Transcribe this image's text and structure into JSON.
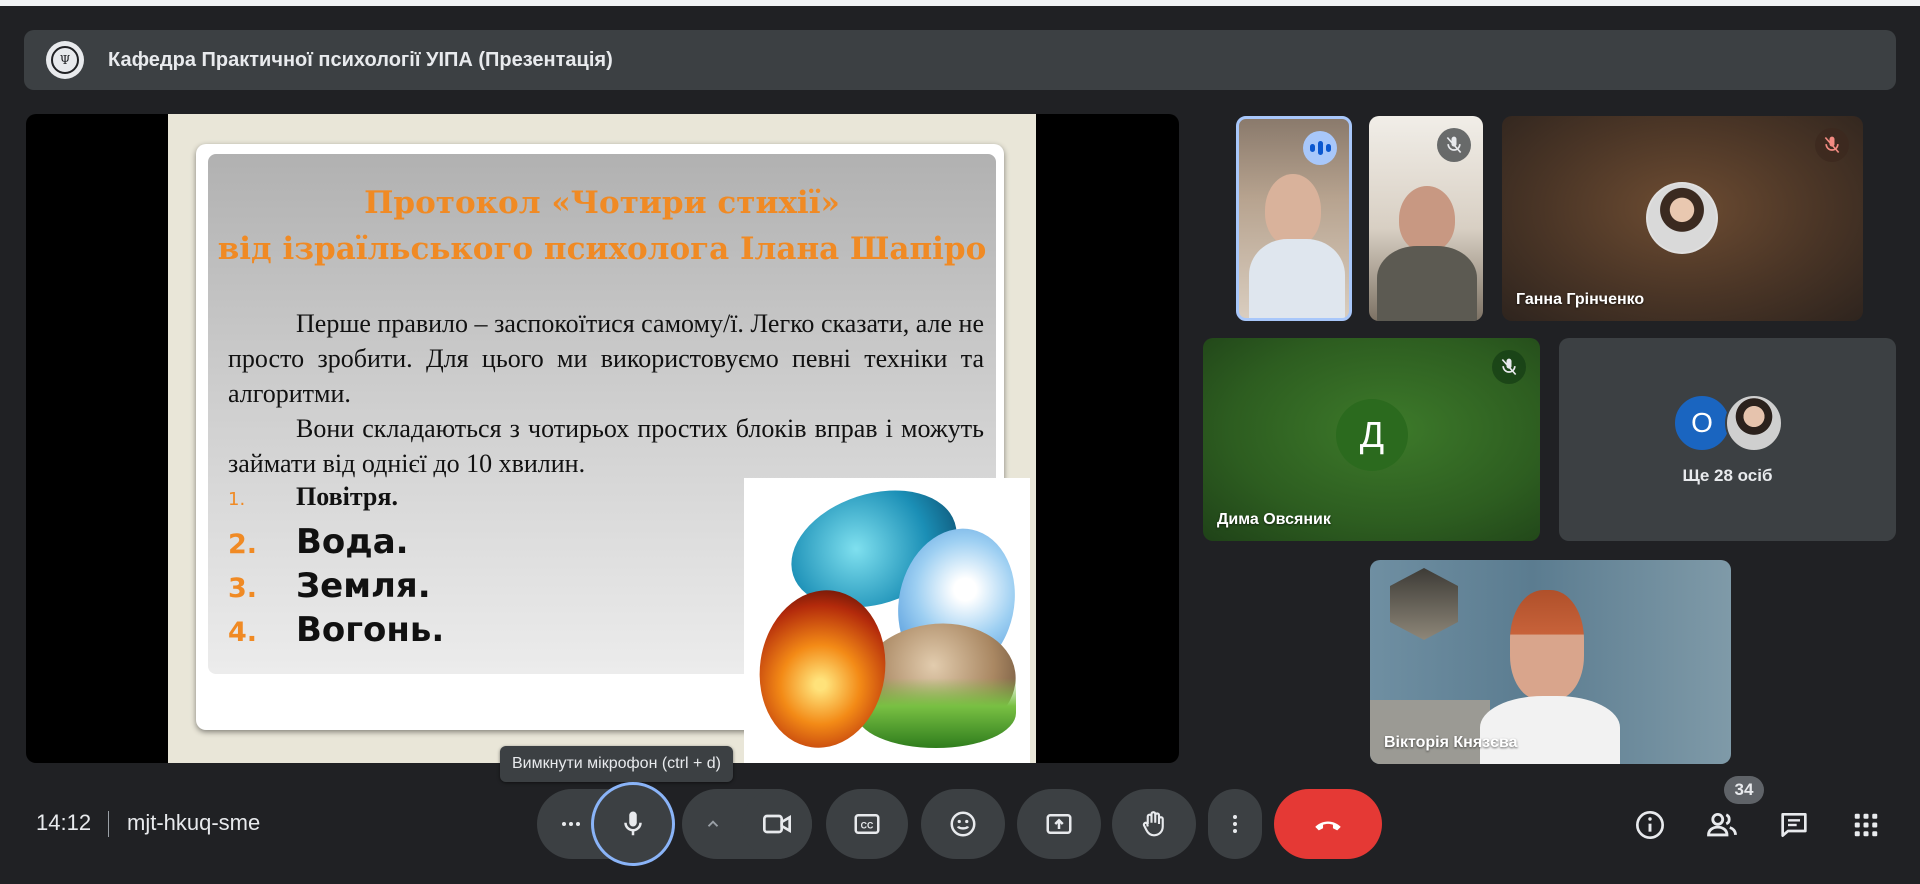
{
  "meeting": {
    "presentation_title": "Кафедра Практичної психології УІПА (Презентація)",
    "time": "14:12",
    "code": "mjt-hkuq-sme",
    "participant_count": "34"
  },
  "slide": {
    "title_line1": "Протокол «Чотири стихії»",
    "title_line2": "від ізраїльського психолога Ілана Шапіро",
    "paragraph1": "Перше правило – заспокоїтися самому/ї. Легко сказати, але не просто зробити. Для цього ми використовуємо певні техніки та алгоритми.",
    "paragraph2": "Вони складаються з чотирьох простих блоків вправ і можуть займати від однієї до 10 хвилин.",
    "list": [
      {
        "num": "1.",
        "text": "Повітря."
      },
      {
        "num": "2.",
        "text": "Вода."
      },
      {
        "num": "3.",
        "text": "Земля."
      },
      {
        "num": "4.",
        "text": "Вогонь."
      }
    ]
  },
  "participants": {
    "ganna": "Ганна Грінченко",
    "dima": "Дима Овсяник",
    "dima_initial": "Д",
    "more_initial": "О",
    "more_label": "Ще 28 осіб",
    "viktoriia": "Вікторія Князєва"
  },
  "tooltip": "Вимкнути мікрофон (ctrl + d)",
  "colors": {
    "accent": "#8ab4f8",
    "end_call": "#e53935",
    "slide_title": "#f08a24"
  },
  "icons": {
    "more_options": "more-horiz-icon",
    "mic": "mic-icon",
    "caret": "chevron-up-icon",
    "camera": "videocam-icon",
    "captions": "closed-caption-icon",
    "emoji": "emoji-icon",
    "present": "present-screen-icon",
    "hand": "raise-hand-icon",
    "more_vert": "more-vert-icon",
    "end": "call-end-icon",
    "info": "info-icon",
    "people": "people-icon",
    "chat": "chat-icon",
    "activities": "apps-grid-icon"
  }
}
